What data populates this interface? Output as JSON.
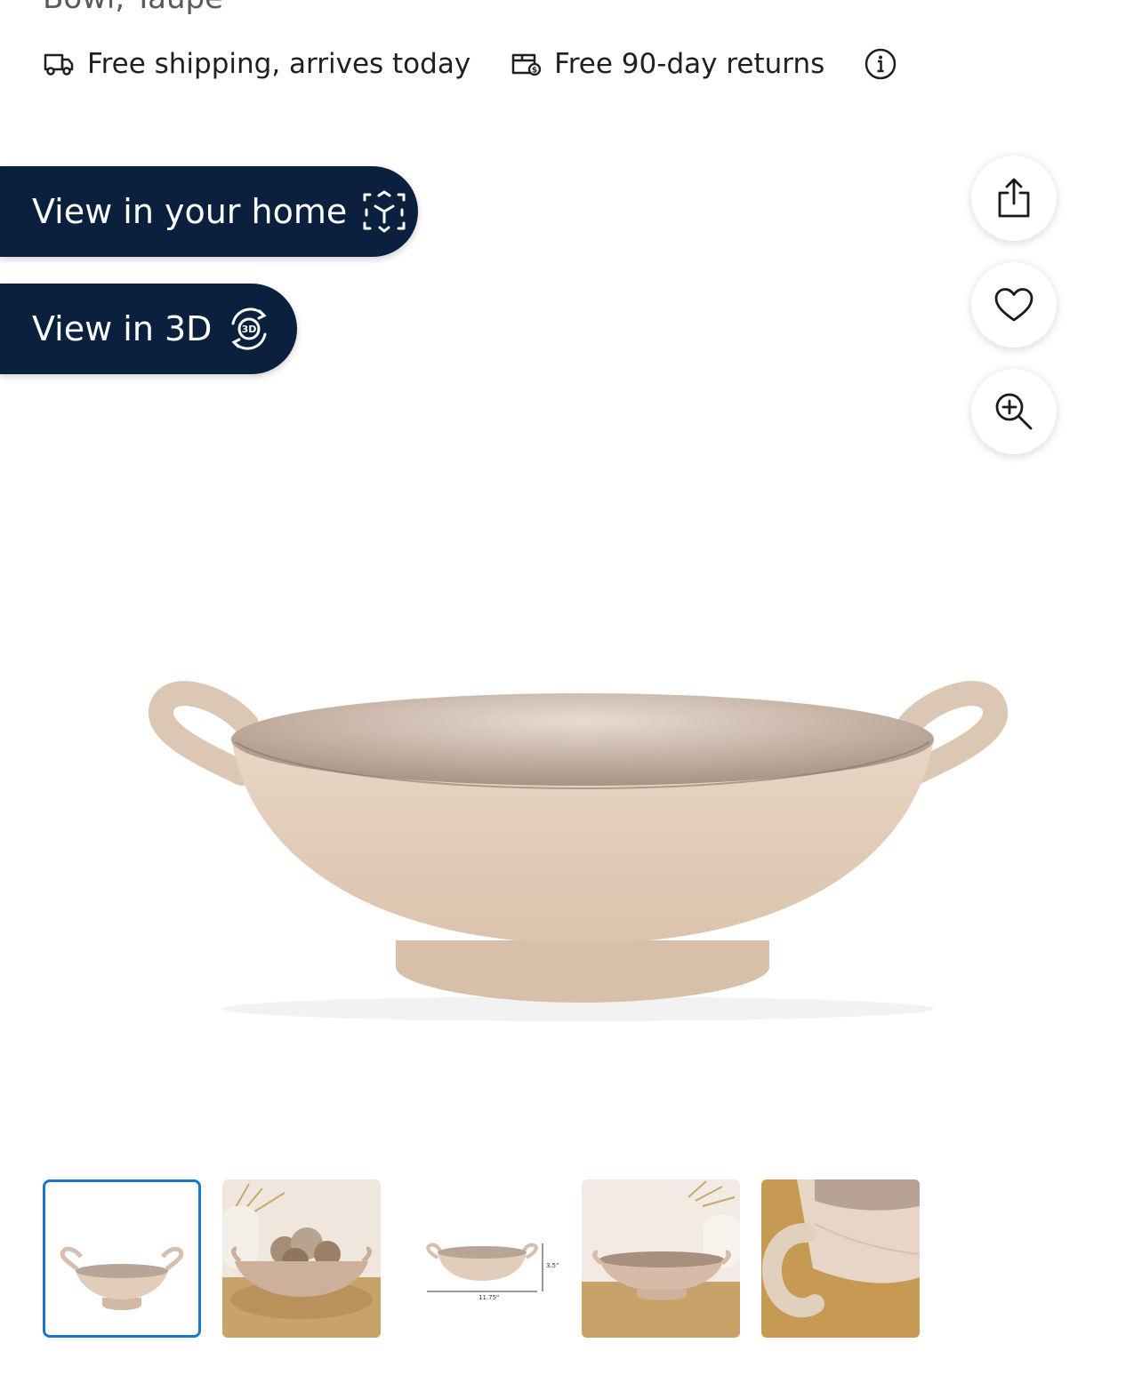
{
  "product": {
    "title_fragment": "Bowl, Taupe"
  },
  "info": {
    "shipping_text": "Free shipping, arrives today",
    "returns_text": "Free 90-day returns",
    "shipping_icon": "truck-icon",
    "returns_icon": "returns-icon",
    "info_icon": "info-icon"
  },
  "actions": {
    "view_home_label": "View in your home",
    "view_3d_label": "View in 3D",
    "view_home_icon": "ar-cube-icon",
    "view_3d_icon": "rotate-3d-icon",
    "three_d_badge": "3D",
    "share_icon": "share-icon",
    "favorite_icon": "heart-icon",
    "zoom_icon": "zoom-in-icon"
  },
  "gallery": {
    "selected_index": 0,
    "dimension_height": "3.5\"",
    "dimension_width": "11.75\""
  },
  "colors": {
    "pill_bg": "#0b1f3e",
    "selected_border": "#1a75cf",
    "bowl": "#e6d3c3"
  }
}
